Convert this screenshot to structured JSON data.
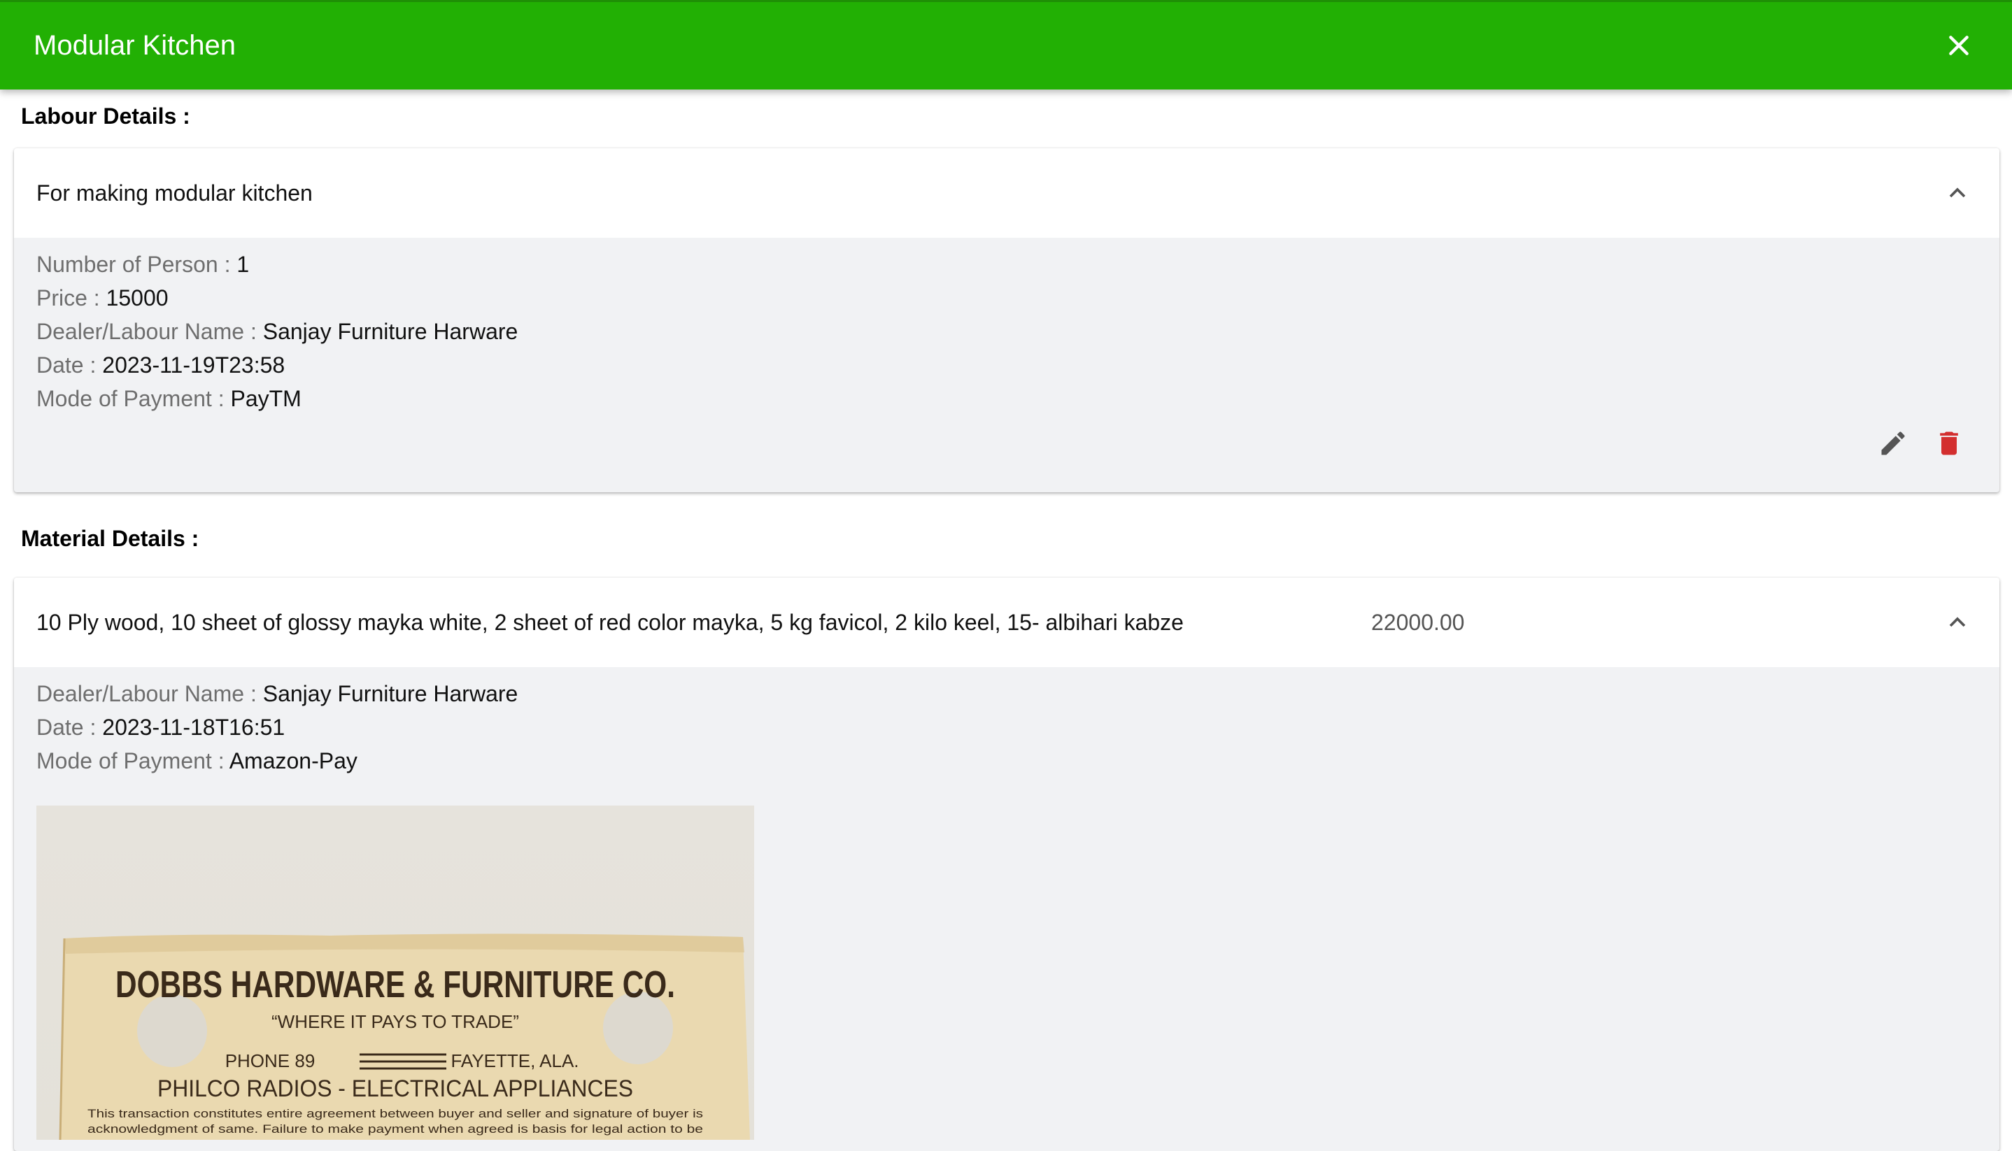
{
  "appbar": {
    "title": "Modular Kitchen",
    "close_icon": "close-icon",
    "color": "#22b004"
  },
  "labour": {
    "heading": "Labour Details :",
    "item": {
      "title": "For making modular kitchen",
      "fields": [
        {
          "label": "Number of Person : ",
          "value": "1"
        },
        {
          "label": "Price : ",
          "value": "15000"
        },
        {
          "label": "Dealer/Labour Name : ",
          "value": "Sanjay Furniture Harware"
        },
        {
          "label": "Date : ",
          "value": "2023-11-19T23:58"
        },
        {
          "label": "Mode of Payment : ",
          "value": "PayTM"
        }
      ],
      "edit_icon": "pencil-icon",
      "delete_icon": "trash-icon",
      "delete_color": "#d32f2f"
    }
  },
  "material": {
    "heading": "Material Details :",
    "item": {
      "title": "10 Ply wood, 10 sheet of glossy mayka white, 2 sheet of red color mayka, 5 kg favicol, 2 kilo keel, 15- albihari kabze",
      "amount": "22000.00",
      "fields": [
        {
          "label": "Dealer/Labour Name : ",
          "value": "Sanjay Furniture Harware"
        },
        {
          "label": "Date : ",
          "value": "2023-11-18T16:51"
        },
        {
          "label": "Mode of Payment : ",
          "value": "Amazon-Pay"
        }
      ],
      "receipt": {
        "company": "DOBBS HARDWARE & FURNITURE CO.",
        "slogan": "“WHERE IT PAYS TO TRADE”",
        "phone": "PHONE 89",
        "city": "FAYETTE, ALA.",
        "tagline": "PHILCO RADIOS - ELECTRICAL APPLIANCES",
        "fine_print_1": "This transaction constitutes entire agreement between buyer and seller and signature of buyer is",
        "fine_print_2": "acknowledgment of same. Failure to make payment when agreed is basis for legal action to be"
      }
    }
  }
}
